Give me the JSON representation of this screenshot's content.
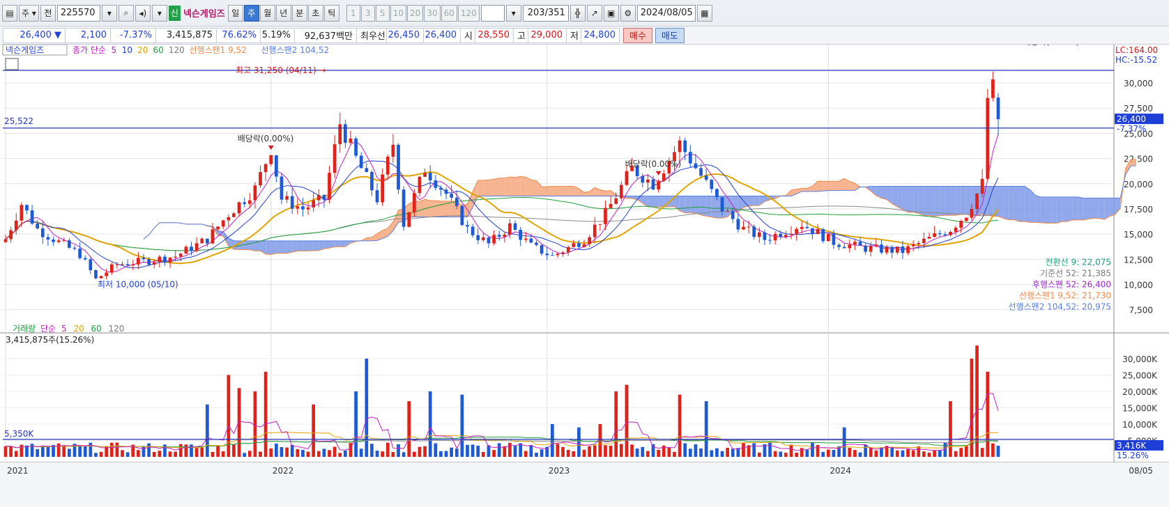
{
  "toolbar": {
    "main_dropdown": "주",
    "prev_label": "전",
    "code": "225570",
    "new_badge": "신",
    "stock_name": "넥슨게임즈",
    "periods": [
      "일",
      "주",
      "월",
      "년",
      "분",
      "초",
      "틱"
    ],
    "active_period": "주",
    "intervals": [
      "1",
      "3",
      "5",
      "10",
      "20",
      "30",
      "60",
      "120"
    ],
    "count": "203",
    "total": "/351",
    "date": "2024/08/05"
  },
  "quote": {
    "price": "26,400",
    "arrow": "▼",
    "change": "2,100",
    "change_pct": "-7.37%",
    "volume": "3,415,875",
    "vol_ratio": "76.62%",
    "turnover": "5.19%",
    "amount": "92,637백만",
    "best_label": "최우선",
    "best_ask": "26,450",
    "best_bid": "26,400",
    "open_label": "시",
    "open": "28,550",
    "high_label": "고",
    "high": "29,000",
    "low_label": "저",
    "low": "24,800",
    "buy_label": "매수",
    "sell_label": "매도"
  },
  "chart_data": {
    "type": "candlestick",
    "stock_label": "넥슨게임즈",
    "legend": [
      {
        "text": "종가 단순",
        "color": "#c21fc1"
      },
      {
        "text": "5",
        "color": "#c21fc1"
      },
      {
        "text": "10",
        "color": "#1f3fd0"
      },
      {
        "text": "20",
        "color": "#e0a400"
      },
      {
        "text": "60",
        "color": "#1e9e3a"
      },
      {
        "text": "120",
        "color": "#7b7b7b"
      },
      {
        "text": "선행스팬1 9,52",
        "color": "#f0884a"
      },
      {
        "text": "선행스팬2 104,52",
        "color": "#5b7fe0"
      }
    ],
    "ylim": [
      6300,
      32700
    ],
    "y_ticks": [
      7500,
      10000,
      12500,
      15000,
      17500,
      20000,
      22500,
      25000,
      27500,
      30000
    ],
    "y_tick_labels": [
      "7,500",
      "10,000",
      "12,500",
      "15,000",
      "17,500",
      "20,000",
      "22,500",
      "25,000",
      "27,500",
      "30,000"
    ],
    "hline_value": 25522,
    "hline_label": "25,522",
    "hline2_value": 31250,
    "lc_label": "LC:164.00",
    "hc_label": "HC:-15.52",
    "last_price_label": "26,400",
    "last_pct_label": "-7.37%",
    "max_annot": "최고 31,250 (04/11) →",
    "min_annot": "최저 10,000 (05/10)",
    "dividend": [
      {
        "label": "배당락(0.00%)",
        "index": 50
      },
      {
        "label": "배당락(0.00%)",
        "index": 123
      },
      {
        "label": "배당락(0.00%)",
        "index": 198
      }
    ],
    "indicator_values": [
      {
        "text": "전환선 9: 22,075",
        "color": "#1e9e78"
      },
      {
        "text": "기준선 52: 21,385",
        "color": "#777777"
      },
      {
        "text": "후행스팬 52: 26,400",
        "color": "#9a28c8"
      },
      {
        "text": "선행스팬1 9,52: 21,730",
        "color": "#f0884a"
      },
      {
        "text": "선행스팬2 104,52: 20,975",
        "color": "#5b7fe0"
      }
    ],
    "x_labels": [
      {
        "text": "2021",
        "index": 0
      },
      {
        "text": "2022",
        "index": 50
      },
      {
        "text": "2023",
        "index": 102
      },
      {
        "text": "2024",
        "index": 155
      }
    ],
    "x_right_label": "08/05",
    "n_candles": 188,
    "keypoints": [
      [
        0,
        14500
      ],
      [
        3,
        18000
      ],
      [
        6,
        15500
      ],
      [
        10,
        14200
      ],
      [
        14,
        13000
      ],
      [
        17,
        10500
      ],
      [
        21,
        12000
      ],
      [
        26,
        12300
      ],
      [
        32,
        12800
      ],
      [
        38,
        14500
      ],
      [
        42,
        17000
      ],
      [
        47,
        19500
      ],
      [
        50,
        23500
      ],
      [
        52,
        18500
      ],
      [
        56,
        17500
      ],
      [
        60,
        18500
      ],
      [
        63,
        26000
      ],
      [
        66,
        22500
      ],
      [
        70,
        18500
      ],
      [
        73,
        24000
      ],
      [
        75,
        16000
      ],
      [
        79,
        21500
      ],
      [
        83,
        19000
      ],
      [
        87,
        15500
      ],
      [
        91,
        14000
      ],
      [
        95,
        15800
      ],
      [
        99,
        13800
      ],
      [
        103,
        12800
      ],
      [
        109,
        14500
      ],
      [
        113,
        17000
      ],
      [
        118,
        21500
      ],
      [
        122,
        20000
      ],
      [
        127,
        24000
      ],
      [
        132,
        20000
      ],
      [
        135,
        17500
      ],
      [
        139,
        15500
      ],
      [
        143,
        14500
      ],
      [
        150,
        16000
      ],
      [
        156,
        14200
      ],
      [
        162,
        13600
      ],
      [
        169,
        13300
      ],
      [
        173,
        14300
      ],
      [
        178,
        15500
      ],
      [
        181,
        17000
      ],
      [
        184,
        20000
      ],
      [
        185,
        28500
      ],
      [
        186,
        29500
      ],
      [
        187,
        26400
      ]
    ],
    "volume_panel": {
      "legend": [
        {
          "text": "거래량",
          "color": "#1e9e3a"
        },
        {
          "text": "단순",
          "color": "#c21fc1"
        },
        {
          "text": "5",
          "color": "#c21fc1"
        },
        {
          "text": "20",
          "color": "#e0a400"
        },
        {
          "text": "60",
          "color": "#1e9e3a"
        },
        {
          "text": "120",
          "color": "#7b7b7b"
        }
      ],
      "current_volume": "3,415,875주(15.26%)",
      "ylim": [
        0,
        37000
      ],
      "y_ticks": [
        5000,
        10000,
        15000,
        20000,
        25000,
        30000
      ],
      "y_tick_labels": [
        "5,000K",
        "10,000K",
        "15,000K",
        "20,000K",
        "25,000K",
        "30,000K"
      ],
      "hline_value": 5350,
      "hline_label": "5,350K",
      "last_label": "3,416K",
      "last_pct": "15.26%",
      "spikes": [
        [
          38,
          16000
        ],
        [
          42,
          25000
        ],
        [
          44,
          21000
        ],
        [
          47,
          20000
        ],
        [
          49,
          26000
        ],
        [
          58,
          16000
        ],
        [
          66,
          20000
        ],
        [
          68,
          30000
        ],
        [
          76,
          17000
        ],
        [
          80,
          20000
        ],
        [
          86,
          19000
        ],
        [
          103,
          10000
        ],
        [
          108,
          9000
        ],
        [
          112,
          10000
        ],
        [
          115,
          20000
        ],
        [
          117,
          22000
        ],
        [
          127,
          19000
        ],
        [
          132,
          17000
        ],
        [
          158,
          9000
        ],
        [
          178,
          17000
        ],
        [
          182,
          30000
        ],
        [
          183,
          34000
        ],
        [
          185,
          26000
        ]
      ]
    }
  }
}
